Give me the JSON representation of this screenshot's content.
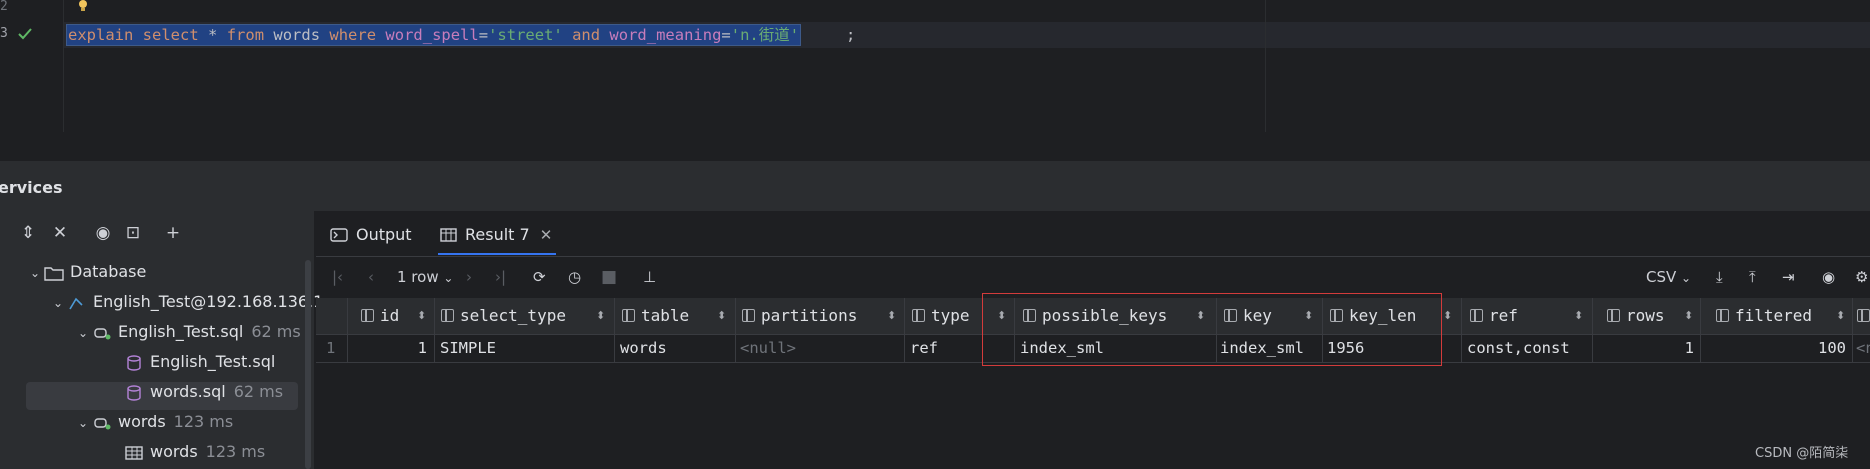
{
  "editor": {
    "line_numbers": [
      "2",
      "3"
    ],
    "code": {
      "explain": "explain",
      "select": "select",
      "star": "*",
      "from": "from",
      "table": "words",
      "where": "where",
      "col1": "word_spell",
      "eq1": "=",
      "val1": "'street'",
      "and": "and",
      "col2": "word_meaning",
      "eq2": "=",
      "val2": "'n.街道'",
      "semicolon": ";"
    }
  },
  "services": {
    "title": "ervices",
    "tree": [
      {
        "label": "Database",
        "time": ""
      },
      {
        "label": "English_Test@192.168.136.1",
        "time": ""
      },
      {
        "label": "English_Test.sql",
        "time": "62 ms"
      },
      {
        "label": "English_Test.sql",
        "time": ""
      },
      {
        "label": "words.sql",
        "time": "62 ms"
      },
      {
        "label": "words",
        "time": "123 ms"
      },
      {
        "label": "words",
        "time": "123 ms"
      }
    ]
  },
  "tabs": [
    {
      "label": "Output",
      "icon": "terminal-icon"
    },
    {
      "label": "Result 7",
      "icon": "table-icon"
    }
  ],
  "result_toolbar": {
    "rows_label": "1 row",
    "export_format": "CSV"
  },
  "grid": {
    "columns": [
      "id",
      "select_type",
      "table",
      "partitions",
      "type",
      "possible_keys",
      "key",
      "key_len",
      "ref",
      "rows",
      "filtered"
    ],
    "row_number": "1",
    "row": [
      "1",
      "SIMPLE",
      "words",
      "<null>",
      "ref",
      "index_sml",
      "index_sml",
      "1956",
      "const,const",
      "1",
      "100",
      "<n"
    ]
  },
  "watermark": "CSDN @陌简柒",
  "colors": {
    "highlight_box": "#d33b3b",
    "selection": "#214283",
    "accent": "#3574f0"
  }
}
